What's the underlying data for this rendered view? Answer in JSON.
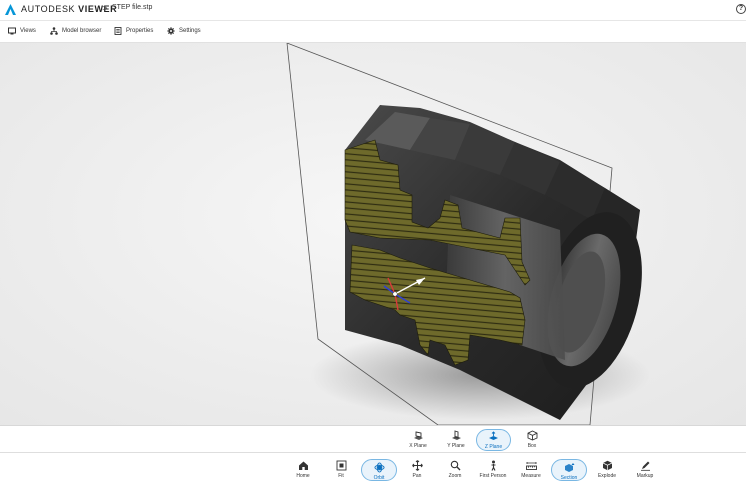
{
  "header": {
    "brand_company": "AUTODESK",
    "brand_product": "VIEWER",
    "breadcrumb_arrow": ">",
    "file_name": "STEP file.stp",
    "help_label": "?"
  },
  "toolbar": {
    "items": [
      {
        "label": "Views",
        "icon": "monitor-icon"
      },
      {
        "label": "Model browser",
        "icon": "tree-icon"
      },
      {
        "label": "Properties",
        "icon": "properties-icon"
      },
      {
        "label": "Settings",
        "icon": "gear-icon"
      }
    ]
  },
  "section_toolbar": {
    "items": [
      {
        "label": "X Plane",
        "icon": "x-plane-icon",
        "active": false
      },
      {
        "label": "Y Plane",
        "icon": "y-plane-icon",
        "active": false
      },
      {
        "label": "Z Plane",
        "icon": "z-plane-icon",
        "active": true
      },
      {
        "label": "Box",
        "icon": "box-icon",
        "active": false
      }
    ]
  },
  "main_toolbar": {
    "items": [
      {
        "label": "Home",
        "icon": "home-icon",
        "active": false
      },
      {
        "label": "Fit",
        "icon": "fit-icon",
        "active": false
      },
      {
        "label": "Orbit",
        "icon": "orbit-icon",
        "active": true
      },
      {
        "label": "Pan",
        "icon": "pan-icon",
        "active": false
      },
      {
        "label": "Zoom",
        "icon": "zoom-icon",
        "active": false
      },
      {
        "label": "First Person",
        "icon": "first-person-icon",
        "active": false
      },
      {
        "label": "Measure",
        "icon": "measure-icon",
        "active": false
      },
      {
        "label": "Section",
        "icon": "section-icon",
        "active": true
      },
      {
        "label": "Explode",
        "icon": "explode-icon",
        "active": false
      },
      {
        "label": "Markup",
        "icon": "markup-icon",
        "active": false
      }
    ]
  },
  "colors": {
    "accent": "#0a6fbf",
    "cut_face": "#6d6a2c",
    "model_dark": "#2e2e2e"
  }
}
